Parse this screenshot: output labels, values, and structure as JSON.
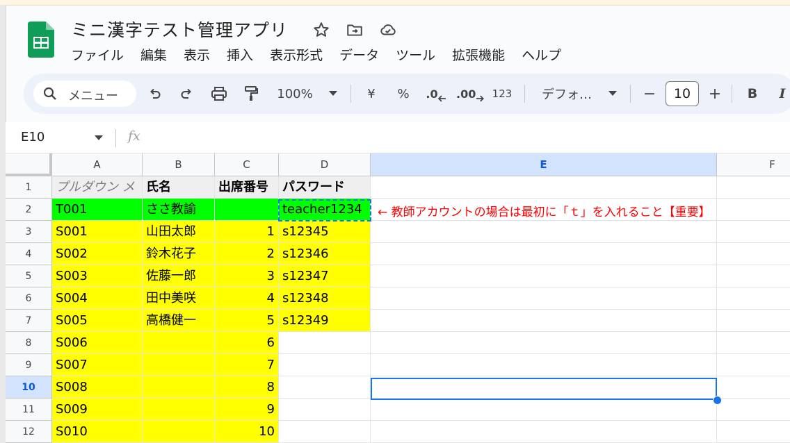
{
  "app": {
    "title": "ミニ漢字テスト管理アプリ",
    "menu": [
      "ファイル",
      "編集",
      "表示",
      "挿入",
      "表示形式",
      "データ",
      "ツール",
      "拡張機能",
      "ヘルプ"
    ]
  },
  "toolbar": {
    "search_label": "メニュー",
    "zoom": "100%",
    "currency": "¥",
    "percent": "%",
    "decrease_decimal": ".0",
    "increase_decimal": ".00",
    "number_format": "123",
    "font": "デフォ…",
    "font_size_minus": "−",
    "font_size": "10",
    "font_size_plus": "+",
    "bold": "B",
    "italic": "I"
  },
  "formula_bar": {
    "name_box": "E10",
    "fx": "fx"
  },
  "sheet": {
    "columns": [
      "A",
      "B",
      "C",
      "D",
      "E",
      "F"
    ],
    "row_numbers": [
      "1",
      "2",
      "3",
      "4",
      "5",
      "6",
      "7",
      "8",
      "9",
      "10",
      "11",
      "12"
    ],
    "selected_column": "E",
    "selected_row": "10",
    "headers": [
      "プルダウン メ",
      "氏名",
      "出席番号",
      "パスワード"
    ],
    "rows": [
      {
        "a": "T001",
        "b": "ささ教諭",
        "c": "",
        "d": "teacher1234"
      },
      {
        "a": "S001",
        "b": "山田太郎",
        "c": "1",
        "d": "s12345"
      },
      {
        "a": "S002",
        "b": "鈴木花子",
        "c": "2",
        "d": "s12346"
      },
      {
        "a": "S003",
        "b": "佐藤一郎",
        "c": "3",
        "d": "s12347"
      },
      {
        "a": "S004",
        "b": "田中美咲",
        "c": "4",
        "d": "s12348"
      },
      {
        "a": "S005",
        "b": "高橋健一",
        "c": "5",
        "d": "s12349"
      },
      {
        "a": "S006",
        "b": "",
        "c": "6",
        "d": ""
      },
      {
        "a": "S007",
        "b": "",
        "c": "7",
        "d": ""
      },
      {
        "a": "S008",
        "b": "",
        "c": "8",
        "d": ""
      },
      {
        "a": "S009",
        "b": "",
        "c": "9",
        "d": ""
      },
      {
        "a": "S010",
        "b": "",
        "c": "10",
        "d": ""
      }
    ],
    "note": "← 教師アカウントの場合は最初に「ｔ」を入れること【重要】"
  },
  "colors": {
    "teacher_row": "#00ff00",
    "student_rows": "#ffff00",
    "note_text": "#ff0000",
    "selection": "#1a73e8",
    "sheets_green": "#0f9d58"
  }
}
